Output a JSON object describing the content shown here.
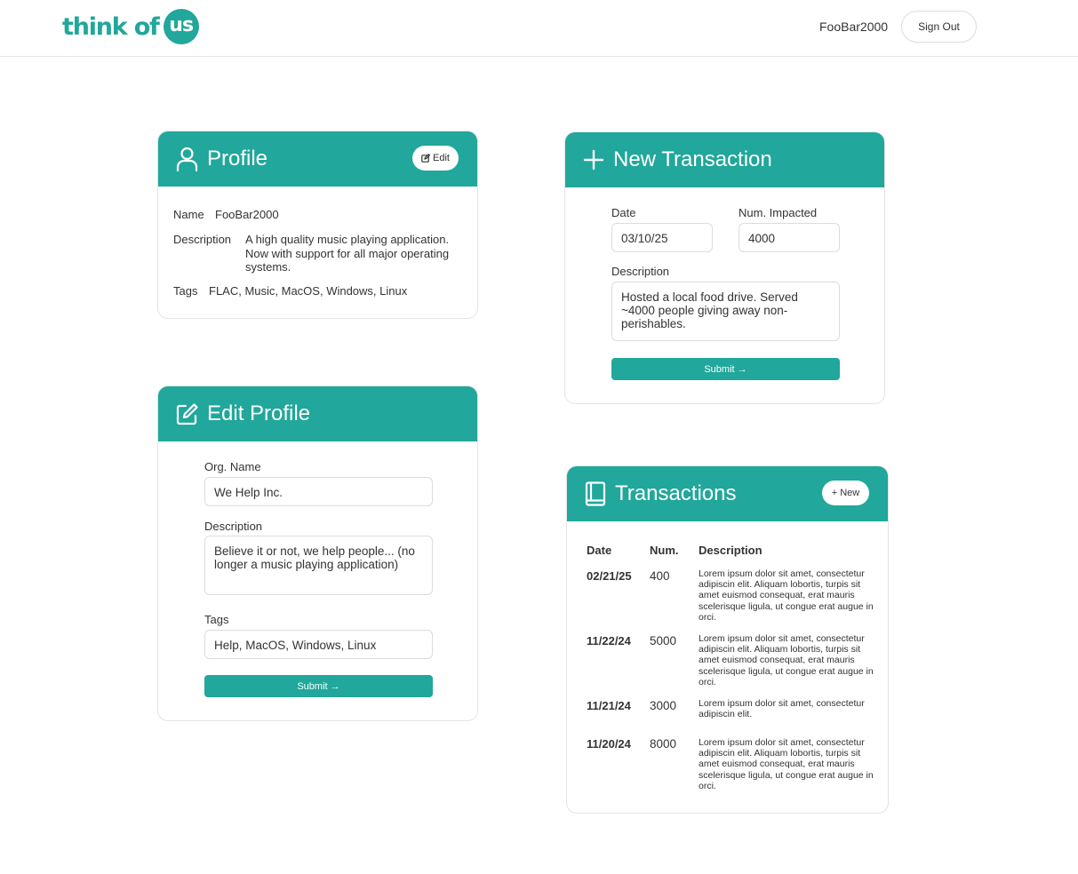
{
  "header": {
    "logo_text": "think of",
    "logo_badge": "us",
    "username": "FooBar2000",
    "signout_label": "Sign Out"
  },
  "profile": {
    "title": "Profile",
    "edit_label": "Edit",
    "name_label": "Name",
    "name_value": "FooBar2000",
    "description_label": "Description",
    "description_value": "A high quality music playing application. Now with support for all major operating systems.",
    "tags_label": "Tags",
    "tags_value": "FLAC, Music, MacOS, Windows, Linux"
  },
  "edit_profile": {
    "title": "Edit Profile",
    "org_label": "Org. Name",
    "org_value": "We Help Inc.",
    "description_label": "Description",
    "description_value": "Believe it or not, we help people... (no longer a music playing application)",
    "tags_label": "Tags",
    "tags_value": "Help, MacOS, Windows, Linux",
    "submit_label": "Submit →"
  },
  "new_transaction": {
    "title": "New Transaction",
    "date_label": "Date",
    "date_value": "03/10/25",
    "num_label": "Num. Impacted",
    "num_value": "4000",
    "description_label": "Description",
    "description_value": "Hosted a local food drive. Served ~4000 people giving away non-perishables.",
    "submit_label": "Submit →"
  },
  "transactions": {
    "title": "Transactions",
    "new_label": "+ New",
    "columns": [
      "Date",
      "Num.",
      "Description"
    ],
    "rows": [
      {
        "date": "02/21/25",
        "num": "400",
        "description": "Lorem ipsum dolor sit amet, consectetur adipiscin elit. Aliquam lobortis, turpis sit amet euismod consequat, erat mauris scelerisque ligula, ut congue erat augue in orci."
      },
      {
        "date": "11/22/24",
        "num": "5000",
        "description": "Lorem ipsum dolor sit amet, consectetur adipiscin elit. Aliquam lobortis, turpis sit amet euismod consequat, erat mauris scelerisque ligula, ut congue erat augue in orci."
      },
      {
        "date": "11/21/24",
        "num": "3000",
        "description": "Lorem ipsum dolor sit amet, consectetur adipiscin elit."
      },
      {
        "date": "11/20/24",
        "num": "8000",
        "description": "Lorem ipsum dolor sit amet, consectetur adipiscin elit. Aliquam lobortis, turpis sit amet euismod consequat, erat mauris scelerisque ligula, ut congue erat augue in orci."
      }
    ]
  },
  "colors": {
    "accent": "#21a79b"
  }
}
